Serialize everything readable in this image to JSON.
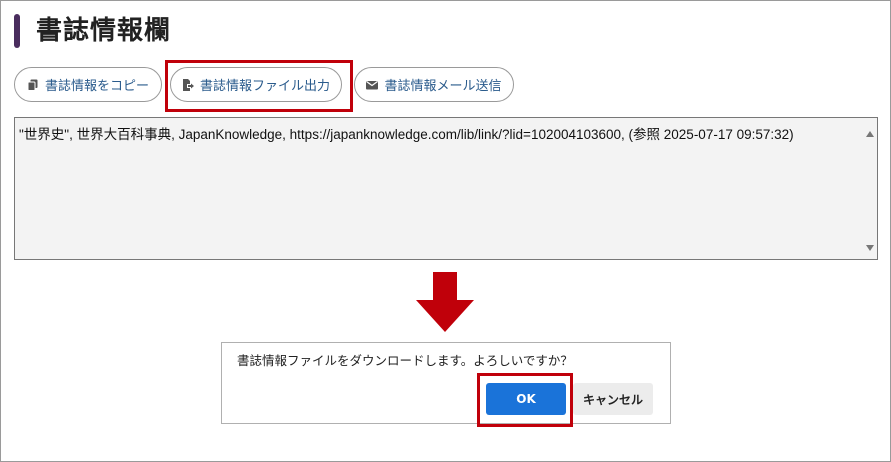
{
  "section": {
    "title": "書誌情報欄"
  },
  "toolbar": {
    "copy_label": "書誌情報をコピー",
    "file_label": "書誌情報ファイル出力",
    "mail_label": "書誌情報メール送信"
  },
  "citation": {
    "text": "\"世界史\", 世界大百科事典, JapanKnowledge, https://japanknowledge.com/lib/link/?lid=102004103600, (参照 2025-07-17 09:57:32)"
  },
  "dialog": {
    "message": "書誌情報ファイルをダウンロードします。よろしいですか？",
    "ok_label": "OK",
    "cancel_label": "キャンセル"
  },
  "colors": {
    "accent_bar": "#4a2d5e",
    "highlight": "#c0000a",
    "ok_button": "#1a73d9",
    "link_text": "#2a5b8c"
  },
  "icons": {
    "copy": "copy-icon",
    "file": "file-export-icon",
    "mail": "mail-icon",
    "arrow": "arrow-down-icon"
  }
}
